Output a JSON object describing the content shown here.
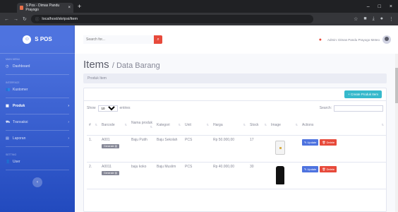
{
  "browser": {
    "tab_title": "S Pos - Dimas Pandu Prayogo",
    "tab_close": "×",
    "new_tab": "+",
    "url": "localhost/skripsi/item",
    "win_min": "–",
    "win_max": "□",
    "win_close": "×"
  },
  "sidebar": {
    "brand": "S POS",
    "heading_main": "MAIN MENU",
    "dashboard": "Dashboard",
    "heading_interface": "INTERFACE",
    "kustomer": "Kustomer",
    "produk": "Produk",
    "transaksi": "Transaksi",
    "laporan": "Laporan",
    "heading_setting": "SETTING",
    "user": "User",
    "arrow": "›",
    "toggle": "‹"
  },
  "topbar": {
    "search_placeholder": "Search for...",
    "user_name": "Admin: Dimas Pandu Prayogo  Meteo"
  },
  "page": {
    "title": "Items",
    "title_sub": "/ Data Barang",
    "breadcrumb": "Produk Item",
    "create_button": "+ Create Produk Item",
    "show": "Show",
    "entries_value": "10",
    "entries": "entries",
    "search_label": "Search:"
  },
  "table": {
    "headers": {
      "num": "#",
      "barcode": "Barcode",
      "nama": "Nama produk",
      "kategori": "Kategori",
      "unit": "Unit",
      "harga": "Harga",
      "stock": "Stock",
      "image": "Image",
      "actions": "Actions"
    },
    "generate_label": "Generate",
    "update_label": "Update",
    "delete_label": "Delete",
    "rows": [
      {
        "num": "1.",
        "barcode": "A001",
        "nama": "Baju Putih",
        "kategori": "Baju Sekolah",
        "unit": "PCS",
        "harga": "Rp 50.000,00",
        "stock": "17"
      },
      {
        "num": "2.",
        "barcode": "A0011",
        "nama": "baju koko",
        "kategori": "Baju Muslim",
        "unit": "PCS",
        "harga": "Rp 40.000,00",
        "stock": "30"
      }
    ]
  },
  "colors": {
    "primary": "#4e73df",
    "danger": "#e74a3b",
    "info": "#36b9cc"
  }
}
